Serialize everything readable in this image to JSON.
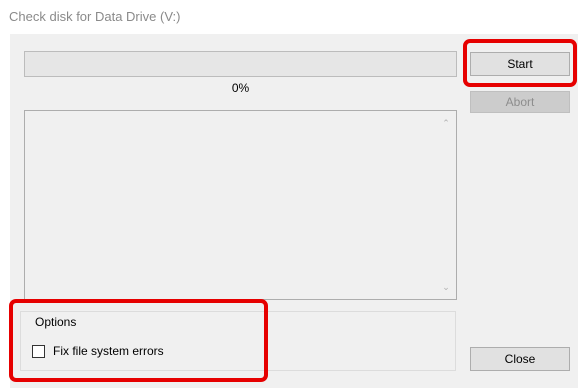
{
  "window": {
    "title": "Check disk for Data Drive (V:)"
  },
  "progress": {
    "value": 0,
    "percent_label": "0%"
  },
  "log": {
    "scroll_up_glyph": "⌃",
    "scroll_down_glyph": "⌄"
  },
  "options": {
    "legend": "Options",
    "fix_errors": {
      "label": "Fix file system errors",
      "checked": false
    }
  },
  "buttons": {
    "start": "Start",
    "abort": "Abort",
    "close": "Close"
  },
  "colors": {
    "highlight": "#e60000",
    "progress_fill": "#06b025"
  }
}
